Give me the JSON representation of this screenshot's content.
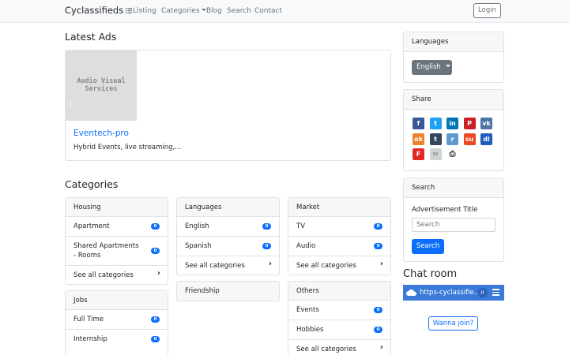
{
  "nav": {
    "brand": "Cyclassifieds",
    "listing": "Listing",
    "categories": "Categories",
    "blog": "Blog",
    "search": "Search",
    "contact": "Contact",
    "login": "Login"
  },
  "latest_ads": {
    "heading": "Latest Ads",
    "image_text_line1": "Audio Visual",
    "image_text_line2": "Services",
    "title": "Eventech-pro",
    "description": "Hybrid Events, live streaming,..."
  },
  "categories": {
    "heading": "Categories",
    "housing": {
      "title": "Housing",
      "items": [
        {
          "label": "Apartment",
          "count": "0"
        },
        {
          "label": "Shared Apartments - Rooms",
          "count": "0"
        }
      ],
      "see_all": "See all categories"
    },
    "languages": {
      "title": "Languages",
      "items": [
        {
          "label": "English",
          "count": "0"
        },
        {
          "label": "Spanish",
          "count": "0"
        }
      ],
      "see_all": "See all categories"
    },
    "market": {
      "title": "Market",
      "items": [
        {
          "label": "TV",
          "count": "0"
        },
        {
          "label": "Audio",
          "count": "0"
        }
      ],
      "see_all": "See all categories"
    },
    "friendship": {
      "title": "Friendship"
    },
    "jobs": {
      "title": "Jobs",
      "items": [
        {
          "label": "Full Time",
          "count": "0"
        },
        {
          "label": "Internship",
          "count": "0"
        }
      ]
    },
    "others": {
      "title": "Others",
      "items": [
        {
          "label": "Events",
          "count": "0"
        },
        {
          "label": "Hobbies",
          "count": "0"
        }
      ],
      "see_all": "See all categories"
    }
  },
  "sidebar": {
    "languages": {
      "title": "Languages",
      "selected": "English"
    },
    "share": {
      "title": "Share",
      "icons": [
        {
          "name": "facebook",
          "glyph": "f",
          "color": "#3b5998"
        },
        {
          "name": "twitter",
          "glyph": "t",
          "color": "#1da1f2"
        },
        {
          "name": "linkedin",
          "glyph": "in",
          "color": "#0077b5"
        },
        {
          "name": "pinterest",
          "glyph": "P",
          "color": "#cb2027"
        },
        {
          "name": "vk",
          "glyph": "vk",
          "color": "#4c75a3"
        },
        {
          "name": "odnoklassniki",
          "glyph": "ok",
          "color": "#ed812b"
        },
        {
          "name": "tumblr",
          "glyph": "t",
          "color": "#35465c"
        },
        {
          "name": "reddit",
          "glyph": "r",
          "color": "#5f99cf"
        },
        {
          "name": "stumbleupon",
          "glyph": "su",
          "color": "#eb4924"
        },
        {
          "name": "delicious",
          "glyph": "dl",
          "color": "#205cc0"
        },
        {
          "name": "flipboard",
          "glyph": "F",
          "color": "#e12828"
        },
        {
          "name": "email",
          "glyph": "✉",
          "color": "#cfd3d6"
        },
        {
          "name": "print",
          "glyph": "⎙",
          "color": "#ffffff"
        }
      ]
    },
    "search": {
      "title": "Search",
      "label": "Advertisement Title",
      "placeholder": "Search",
      "button": "Search"
    }
  },
  "chat": {
    "heading": "Chat room",
    "room": "https-cyclassifieds-com",
    "count": "0",
    "join": "Wanna join?"
  },
  "colors": {
    "primary": "#0d6efd",
    "secondary": "#6c757d",
    "chat": "#3b7ad8"
  }
}
